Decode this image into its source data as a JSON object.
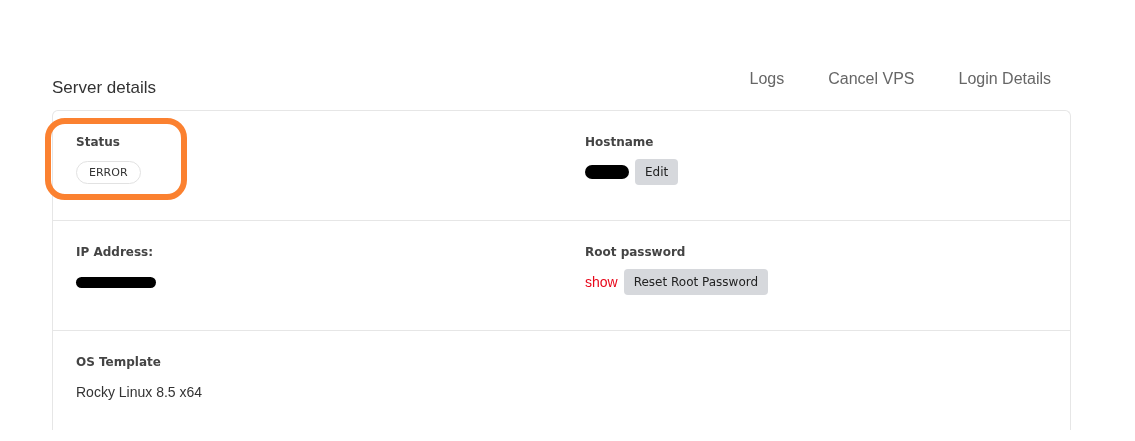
{
  "title": "Server details",
  "links": [
    {
      "label": "Logs"
    },
    {
      "label": "Cancel VPS"
    },
    {
      "label": "Login Details"
    }
  ],
  "rows": [
    {
      "fields": [
        {
          "label": "Status",
          "kind": "badge",
          "value": "ERROR",
          "highlighted": true
        },
        {
          "label": "Hostname",
          "kind": "redacted",
          "action": "Edit",
          "highlighted": false
        }
      ]
    },
    {
      "fields": [
        {
          "label": "IP Address:",
          "kind": "redacted",
          "highlighted": false
        },
        {
          "label": "Root password",
          "kind": "secret",
          "link": "show",
          "action": "Reset Root Password",
          "highlighted": false
        }
      ]
    },
    {
      "fields": [
        {
          "label": "OS Template",
          "kind": "text",
          "value": "Rocky Linux 8.5 x64",
          "highlighted": false
        }
      ]
    }
  ]
}
